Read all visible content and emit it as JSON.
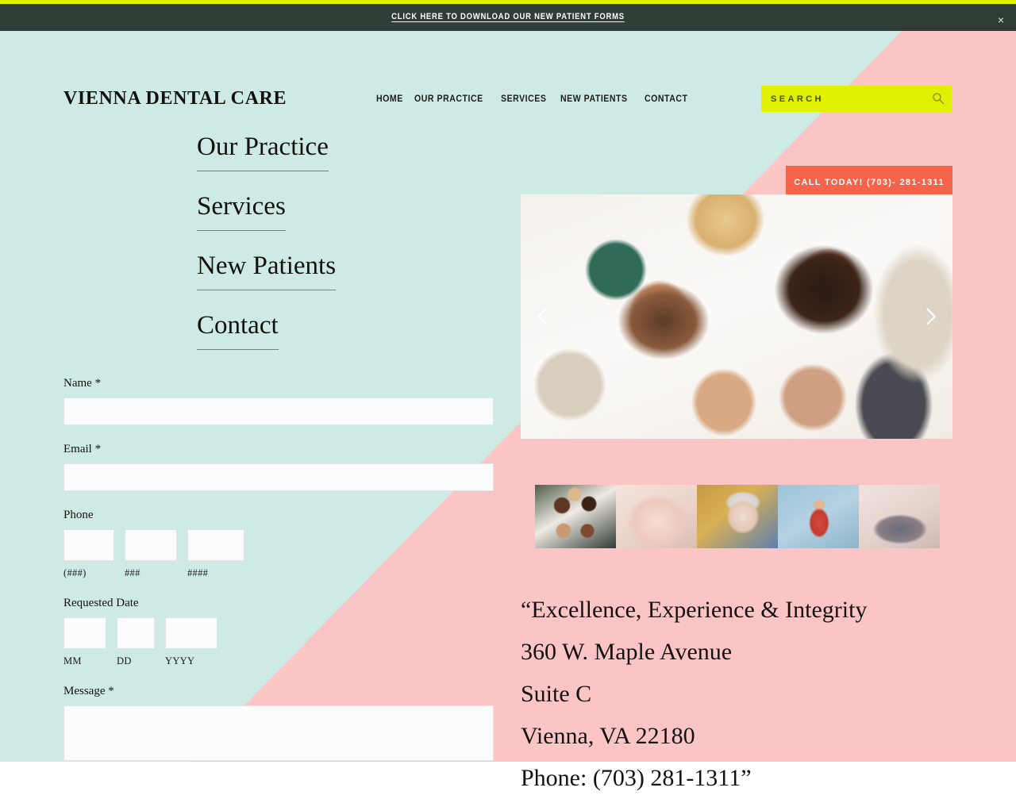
{
  "announcement": {
    "link_text": "CLICK HERE TO DOWNLOAD OUR NEW PATIENT FORMS",
    "close_label": "×",
    "bar_color": "#2f3d36",
    "accent_top_color": "#dff000"
  },
  "colors": {
    "mint": "#cdeae5",
    "pink": "#fcc5c5",
    "search_yellow": "#dff000",
    "call_coral": "#f5634a",
    "text_dark": "#141210"
  },
  "header": {
    "logo": "VIENNA DENTAL CARE",
    "nav": [
      {
        "label": "HOME"
      },
      {
        "label": "OUR PRACTICE"
      },
      {
        "label": "SERVICES"
      },
      {
        "label": "NEW PATIENTS"
      },
      {
        "label": "CONTACT"
      }
    ],
    "search": {
      "placeholder": "SEARCH",
      "value": "",
      "icon": "search-icon"
    },
    "call_button": {
      "label": "CALL TODAY! (703)-  281-1311"
    }
  },
  "big_links": [
    {
      "label": "Our Practice"
    },
    {
      "label": "Services"
    },
    {
      "label": "New Patients"
    },
    {
      "label": "Contact"
    }
  ],
  "form": {
    "name": {
      "label": "Name *",
      "value": ""
    },
    "email": {
      "label": "Email *",
      "value": ""
    },
    "phone": {
      "label": "Phone",
      "parts": [
        {
          "sub_label": "(###)",
          "value": ""
        },
        {
          "sub_label": "###",
          "value": ""
        },
        {
          "sub_label": "####",
          "value": ""
        }
      ]
    },
    "requested_date": {
      "label": "Requested Date",
      "parts": [
        {
          "sub_label": "MM",
          "value": ""
        },
        {
          "sub_label": "DD",
          "value": ""
        },
        {
          "sub_label": "YYYY",
          "value": ""
        }
      ]
    },
    "message": {
      "label": "Message *",
      "value": ""
    }
  },
  "carousel": {
    "prev_icon": "chevron-left-icon",
    "next_icon": "chevron-right-icon",
    "thumbnail_count": 5
  },
  "quote": {
    "line1": "“Excellence, Experience & Integrity",
    "line2": "360 W. Maple Avenue",
    "line3": "Suite C",
    "line4": "Vienna, VA 22180",
    "line5": "Phone: (703) 281-1311”"
  }
}
